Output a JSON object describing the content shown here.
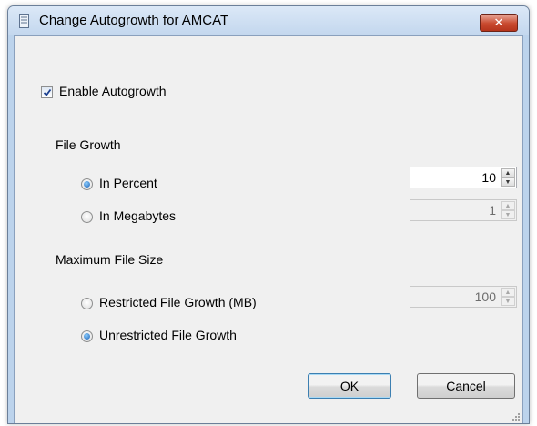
{
  "window": {
    "title": "Change Autogrowth for AMCAT",
    "close_glyph": "✕"
  },
  "autogrowth": {
    "enable_label": "Enable Autogrowth",
    "enabled": true
  },
  "file_growth": {
    "section_label": "File Growth",
    "in_percent_label": "In Percent",
    "in_percent_selected": true,
    "percent_value": "10",
    "in_megabytes_label": "In Megabytes",
    "in_megabytes_selected": false,
    "megabytes_value": "1"
  },
  "max_size": {
    "section_label": "Maximum File Size",
    "restricted_label": "Restricted File Growth (MB)",
    "restricted_selected": false,
    "restricted_value": "100",
    "unrestricted_label": "Unrestricted File Growth",
    "unrestricted_selected": true
  },
  "buttons": {
    "ok_label": "OK",
    "cancel_label": "Cancel"
  },
  "icons": {
    "title_icon": "database-file-icon",
    "close": "close-icon",
    "check": "checkmark-icon",
    "spin_up": "spin-up-icon",
    "spin_down": "spin-down-icon",
    "grip": "resize-grip-icon"
  }
}
